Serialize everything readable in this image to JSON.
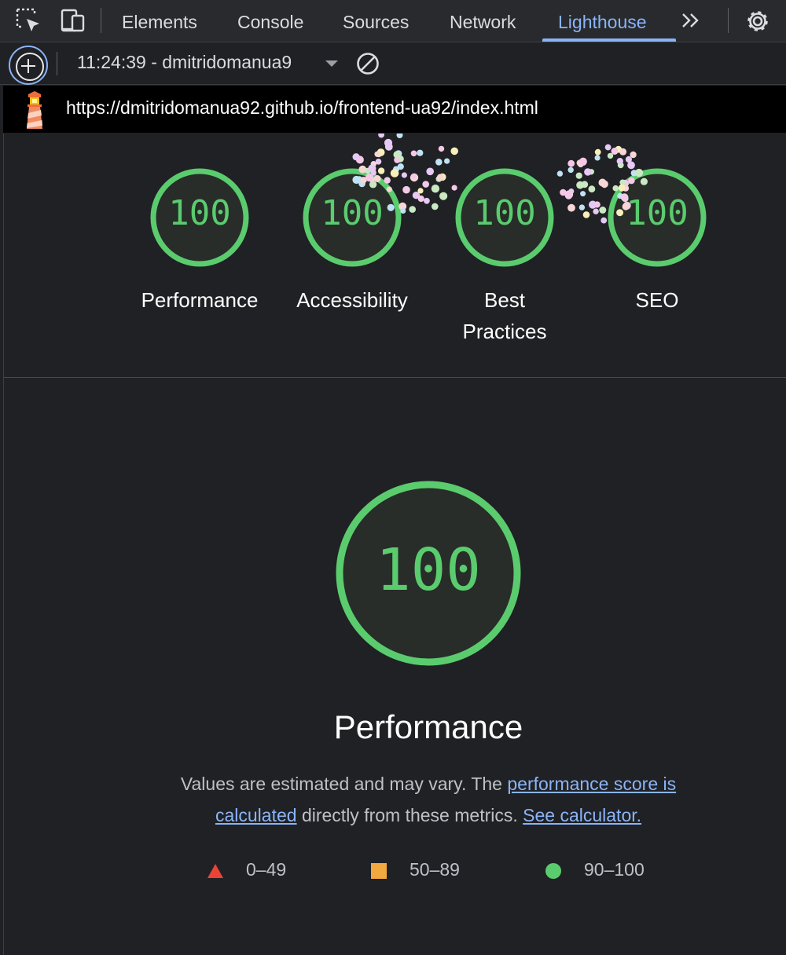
{
  "devtools": {
    "tabs": [
      {
        "label": "Elements"
      },
      {
        "label": "Console"
      },
      {
        "label": "Sources"
      },
      {
        "label": "Network"
      },
      {
        "label": "Lighthouse",
        "active": true
      }
    ],
    "icons": [
      "inspect-element-icon",
      "device-toolbar-icon",
      "more-tabs-icon",
      "settings-icon"
    ]
  },
  "toolbar": {
    "report_select": "11:24:39 - dmitridomanua9",
    "icons": [
      "new-report-icon",
      "dropdown-caret-icon",
      "clear-icon"
    ]
  },
  "url_bar": {
    "url": "https://dmitridomanua92.github.io/frontend-ua92/index.html",
    "icon": "lighthouse-logo-icon"
  },
  "gauges": [
    {
      "score": "100",
      "label": "Performance"
    },
    {
      "score": "100",
      "label": "Accessibility"
    },
    {
      "score": "100",
      "label": "Best Practices"
    },
    {
      "score": "100",
      "label": "SEO"
    }
  ],
  "performance": {
    "score": "100",
    "title": "Performance",
    "desc_1": "Values are estimated and may vary. The ",
    "link_calculated": "performance score is calculated",
    "desc_2": " directly from these metrics. ",
    "link_calculator": "See calculator."
  },
  "legend": [
    {
      "range": "0–49",
      "shape": "triangle",
      "color": "#ea4335"
    },
    {
      "range": "50–89",
      "shape": "square",
      "color": "#f4a940"
    },
    {
      "range": "90–100",
      "shape": "circle",
      "color": "#5acc6e"
    }
  ],
  "colors": {
    "pass": "#5acc6e",
    "link": "#8ab4f8",
    "gauge_fill": "#282d29"
  }
}
